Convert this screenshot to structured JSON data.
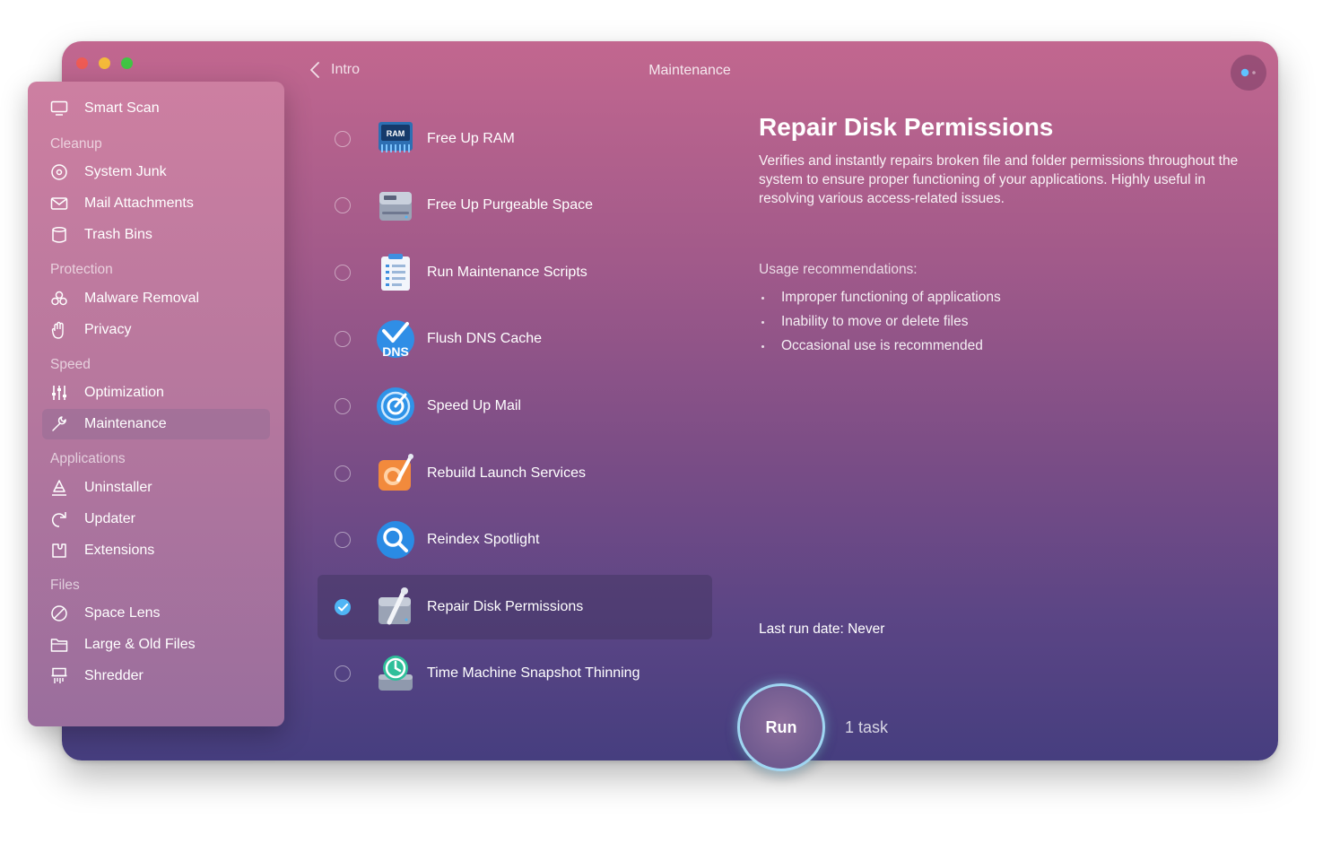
{
  "window": {
    "nav_back_label": "Intro",
    "title": "Maintenance"
  },
  "sidebar": {
    "top_item": {
      "label": "Smart Scan",
      "icon": "monitor-icon"
    },
    "sections": [
      {
        "title": "Cleanup",
        "items": [
          {
            "label": "System Junk",
            "icon": "disc-icon"
          },
          {
            "label": "Mail Attachments",
            "icon": "envelope-icon"
          },
          {
            "label": "Trash Bins",
            "icon": "trash-icon"
          }
        ]
      },
      {
        "title": "Protection",
        "items": [
          {
            "label": "Malware Removal",
            "icon": "biohazard-icon"
          },
          {
            "label": "Privacy",
            "icon": "hand-icon"
          }
        ]
      },
      {
        "title": "Speed",
        "items": [
          {
            "label": "Optimization",
            "icon": "sliders-icon"
          },
          {
            "label": "Maintenance",
            "icon": "wrench-icon",
            "active": true
          }
        ]
      },
      {
        "title": "Applications",
        "items": [
          {
            "label": "Uninstaller",
            "icon": "uninstall-icon"
          },
          {
            "label": "Updater",
            "icon": "update-icon"
          },
          {
            "label": "Extensions",
            "icon": "extension-icon"
          }
        ]
      },
      {
        "title": "Files",
        "items": [
          {
            "label": "Space Lens",
            "icon": "lens-icon"
          },
          {
            "label": "Large & Old Files",
            "icon": "folder-icon"
          },
          {
            "label": "Shredder",
            "icon": "shredder-icon"
          }
        ]
      }
    ]
  },
  "tasks": [
    {
      "label": "Free Up RAM",
      "icon": "ram-chip-icon",
      "icon_text": "RAM",
      "checked": false
    },
    {
      "label": "Free Up Purgeable Space",
      "icon": "hard-drive-icon",
      "checked": false
    },
    {
      "label": "Run Maintenance Scripts",
      "icon": "clipboard-icon",
      "checked": false
    },
    {
      "label": "Flush DNS Cache",
      "icon": "dns-icon",
      "icon_text": "DNS",
      "checked": false
    },
    {
      "label": "Speed Up Mail",
      "icon": "mail-speed-icon",
      "checked": false
    },
    {
      "label": "Rebuild Launch Services",
      "icon": "launch-services-icon",
      "checked": false
    },
    {
      "label": "Reindex Spotlight",
      "icon": "spotlight-icon",
      "checked": false
    },
    {
      "label": "Repair Disk Permissions",
      "icon": "disk-permissions-icon",
      "checked": true
    },
    {
      "label": "Time Machine Snapshot Thinning",
      "icon": "time-machine-icon",
      "checked": false
    }
  ],
  "detail": {
    "title": "Repair Disk Permissions",
    "description": "Verifies and instantly repairs broken file and folder permissions throughout the system to ensure proper functioning of your applications. Highly useful in resolving various access-related issues.",
    "usage_heading": "Usage recommendations:",
    "usage_items": [
      "Improper functioning of applications",
      "Inability to move or delete files",
      "Occasional use is recommended"
    ],
    "last_run_label": "Last run date:",
    "last_run_value": "Never"
  },
  "run": {
    "button_label": "Run",
    "task_count": "1 task"
  },
  "colors": {
    "accent": "#4fb5f5",
    "ring": "#9fd6f2"
  }
}
